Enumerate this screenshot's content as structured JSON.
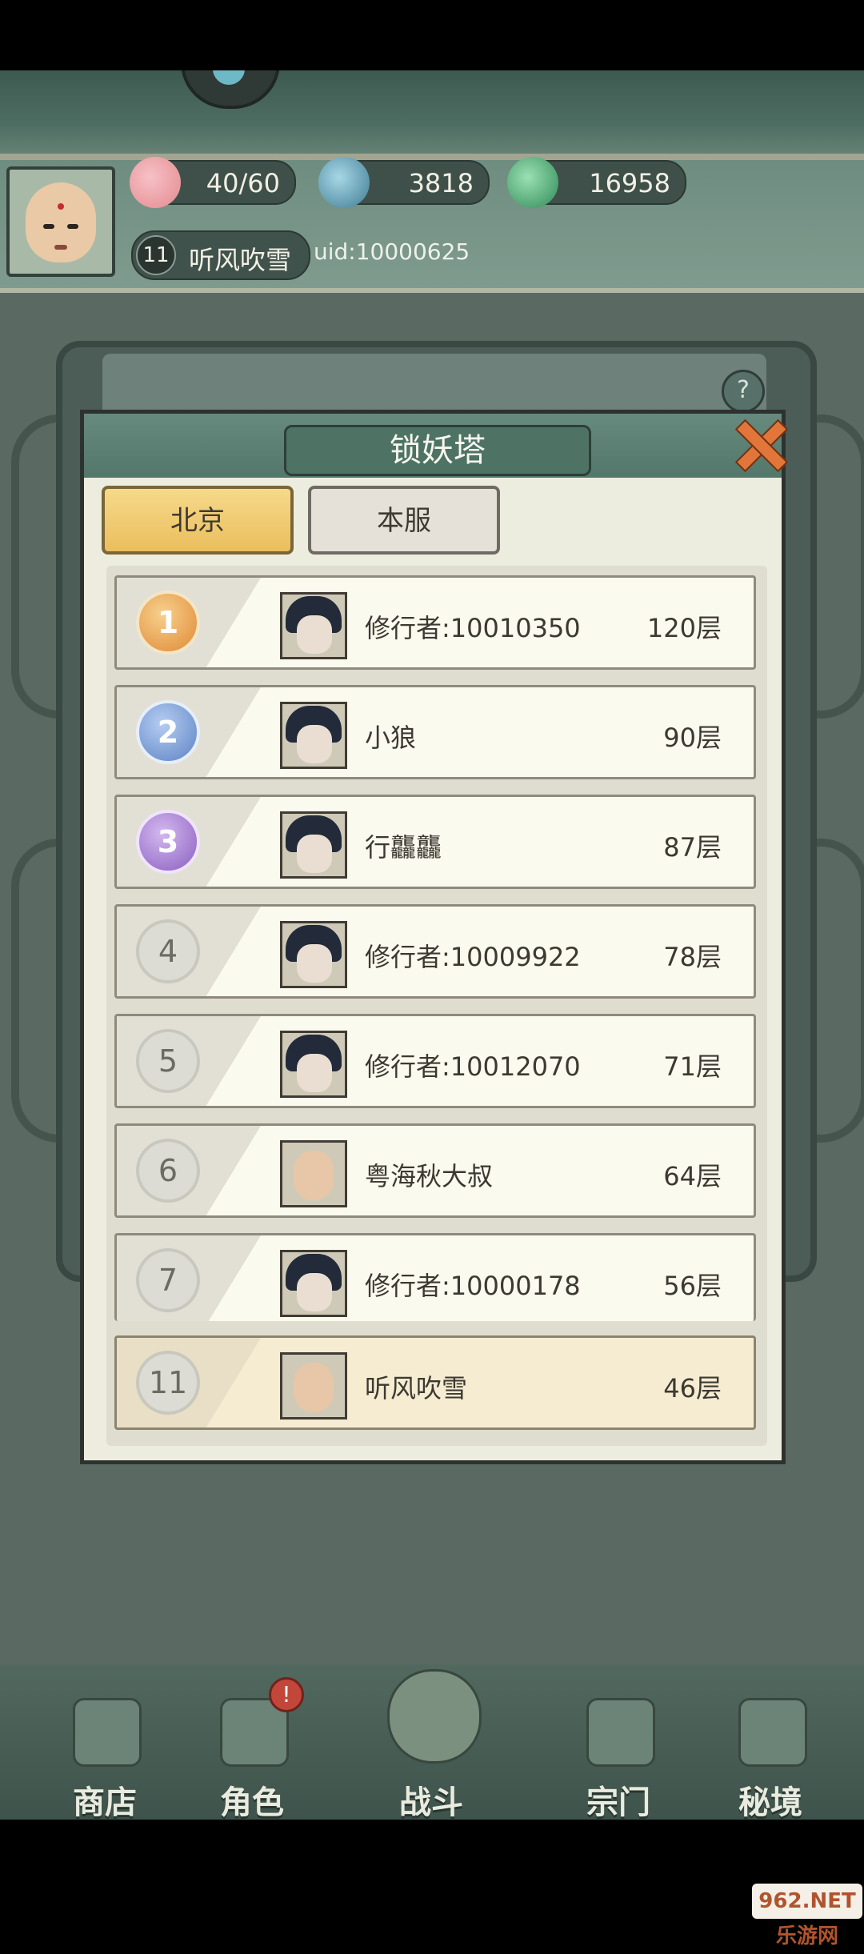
{
  "resources": {
    "stamina": "40/60",
    "gems": "3818",
    "spirit": "16958"
  },
  "player": {
    "level": "11",
    "name": "听风吹雪",
    "uid": "uid:10000625"
  },
  "dialog": {
    "title": "锁妖塔",
    "tabs": [
      "北京",
      "本服"
    ],
    "rows": [
      {
        "rank": "1",
        "name": "修行者:10010350",
        "floor": "120层"
      },
      {
        "rank": "2",
        "name": "小狼",
        "floor": "90层"
      },
      {
        "rank": "3",
        "name": "行龘龘",
        "floor": "87层"
      },
      {
        "rank": "4",
        "name": "修行者:10009922",
        "floor": "78层"
      },
      {
        "rank": "5",
        "name": "修行者:10012070",
        "floor": "71层"
      },
      {
        "rank": "6",
        "name": "粤海秋大叔",
        "floor": "64层"
      },
      {
        "rank": "7",
        "name": "修行者:10000178",
        "floor": "56层"
      }
    ],
    "self_row": {
      "rank": "11",
      "name": "听风吹雪",
      "floor": "46层"
    }
  },
  "nav": {
    "items": [
      "商店",
      "角色",
      "战斗",
      "宗门",
      "秘境"
    ],
    "badge": "!"
  },
  "watermark": "962.NET 乐游网",
  "colors": {
    "tab_active": "#ebbe5d",
    "close": "#e2763a",
    "header": "#5b7f72"
  }
}
